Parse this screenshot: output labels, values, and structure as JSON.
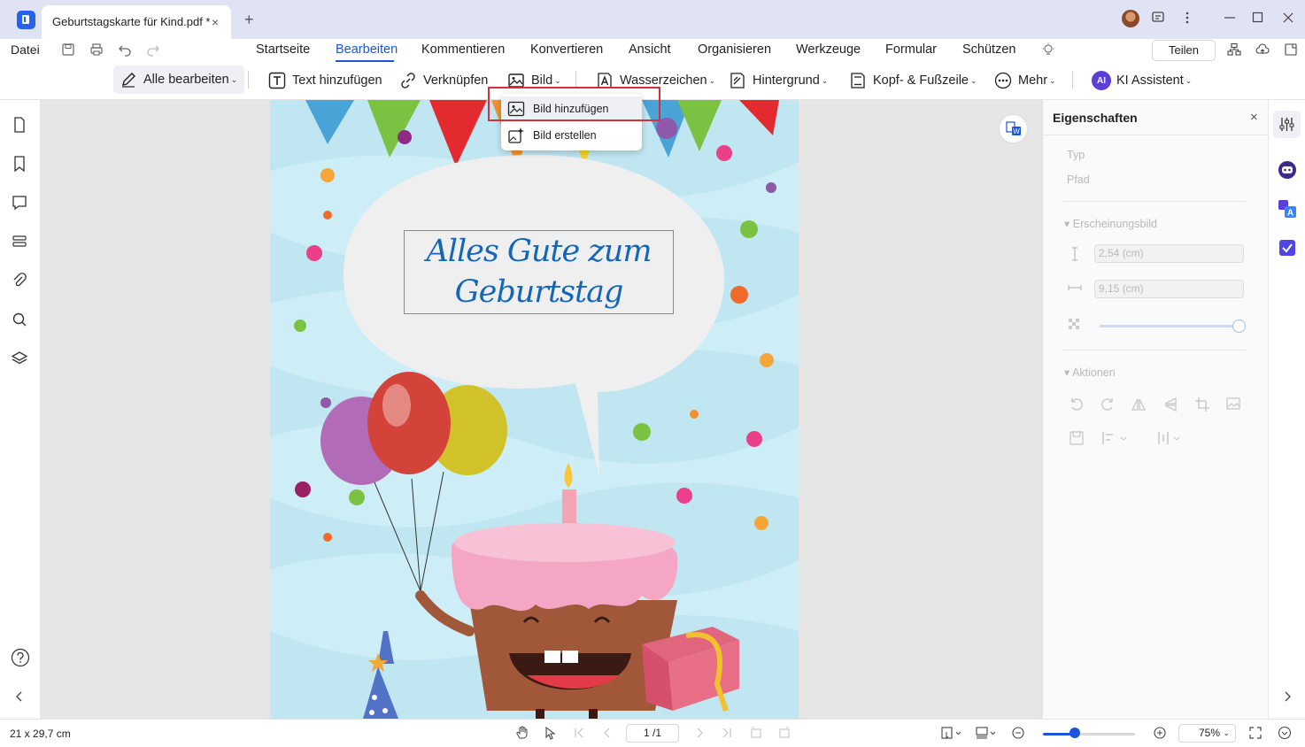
{
  "titlebar": {
    "tab_title": "Geburtstagskarte für Kind.pdf *",
    "tab_close": "×",
    "new_tab": "+",
    "window_controls": [
      "minimize-icon",
      "maximize-icon",
      "close-icon"
    ]
  },
  "menubar": {
    "file": "Datei",
    "tabs": [
      "Startseite",
      "Bearbeiten",
      "Kommentieren",
      "Konvertieren",
      "Ansicht",
      "Organisieren",
      "Werkzeuge",
      "Formular",
      "Schützen"
    ],
    "active_tab": "Bearbeiten",
    "share": "Teilen"
  },
  "toolbar": {
    "edit_all": "Alle bearbeiten",
    "add_text": "Text hinzufügen",
    "link": "Verknüpfen",
    "image": "Bild",
    "watermark": "Wasserzeichen",
    "background": "Hintergrund",
    "header_footer": "Kopf- & Fußzeile",
    "more": "Mehr",
    "ai_badge": "AI",
    "ai_assistant": "KI Assistent"
  },
  "image_menu": {
    "items": [
      {
        "label": "Bild hinzufügen",
        "icon": "image-add-icon"
      },
      {
        "label": "Bild erstellen",
        "icon": "ai-image-icon"
      }
    ]
  },
  "document": {
    "greeting_line1": "Alles Gute zum",
    "greeting_line2": "Geburtstag"
  },
  "properties": {
    "title": "Eigenschaften",
    "close": "×",
    "type_label": "Typ",
    "path_label": "Pfad",
    "appearance_label": "Erscheinungsbild",
    "height_value": "2,54 (cm)",
    "width_value": "9,15 (cm)",
    "opacity": 1.0,
    "actions_label": "Aktionen"
  },
  "statusbar": {
    "page_size": "21 x 29,7 cm",
    "page_indicator": "1 /1",
    "zoom": "75%",
    "zoom_level": 0.35
  },
  "colors": {
    "accent": "#1a56db",
    "highlight": "#d0323c",
    "card_background": "#bfe6f1"
  }
}
